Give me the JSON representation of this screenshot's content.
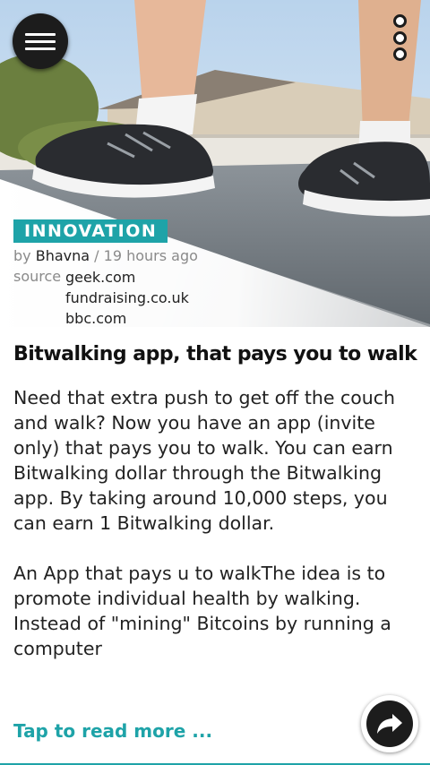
{
  "toolbar": {
    "menu_icon": "hamburger-menu-icon",
    "more_icon": "more-vertical-icon"
  },
  "article": {
    "category": "INNOVATION",
    "by_label": "by",
    "author": "Bhavna",
    "time": "/ 19 hours ago",
    "source_label": "source",
    "sources": [
      "geek.com",
      "fundraising.co.uk",
      "bbc.com"
    ],
    "title": "Bitwalking app, that pays you to walk",
    "paragraphs": [
      "Need that extra push to get off the couch and walk? Now you have an app (invite only) that pays you to walk. You can earn Bitwalking dollar through the Bitwalking app. By taking around 10,000 steps, you can earn 1 Bitwalking dollar.",
      "An App that pays u to walkThe idea is to promote individual health by walking. Instead of \"mining\" Bitcoins by running a computer"
    ],
    "read_more": "Tap to read more ..."
  },
  "actions": {
    "share_icon": "share-arrow-icon"
  },
  "colors": {
    "accent": "#1ea3a8",
    "button_dark": "#1c1c1c"
  }
}
